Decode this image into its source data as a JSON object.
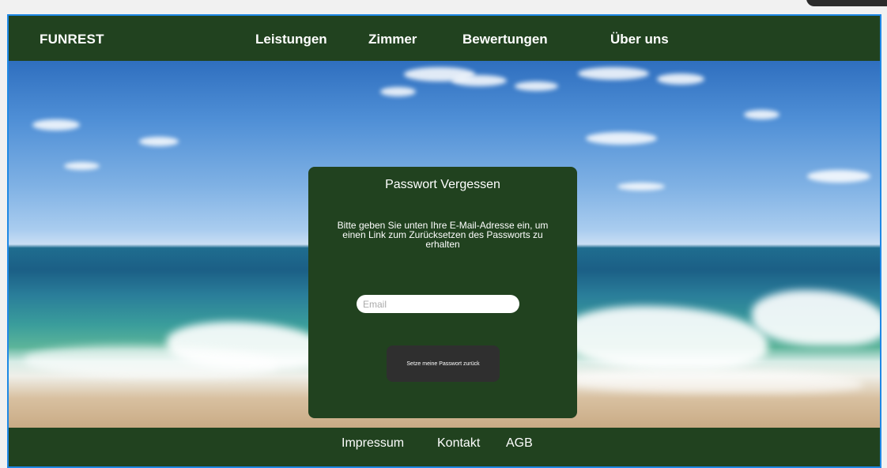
{
  "header": {
    "brand": "FUNREST",
    "nav": [
      "Leistungen",
      "Zimmer",
      "Bewertungen",
      "Über uns"
    ]
  },
  "form": {
    "title": "Passwort Vergessen",
    "description": "Bitte geben Sie unten Ihre E-Mail-Adresse ein, um einen Link zum Zurücksetzen des Passworts zu erhalten",
    "email_placeholder": "Email",
    "email_value": "",
    "button_label": "Setze meine Passwort zurück"
  },
  "footer": {
    "links": [
      "Impressum",
      "Kontakt",
      "AGB"
    ]
  },
  "colors": {
    "brand_green": "#21421f",
    "button_dark": "#2f2f2f",
    "frame_border": "#1e88e5"
  }
}
